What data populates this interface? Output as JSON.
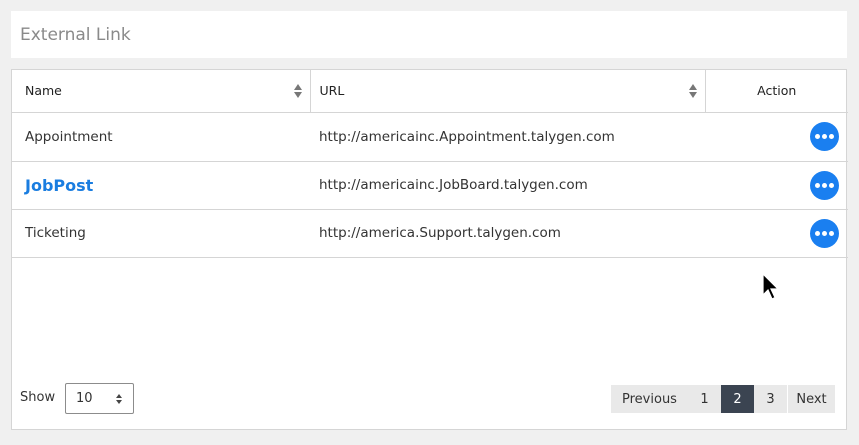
{
  "header": {
    "title": "External Link"
  },
  "table": {
    "columns": {
      "name": "Name",
      "url": "URL",
      "action": "Action"
    },
    "rows": [
      {
        "name": "Appointment",
        "url": "http://americainc.Appointment.talygen.com",
        "action_icon": "more-horizontal-icon"
      },
      {
        "name": "JobPost",
        "url": "http://americainc.JobBoard.talygen.com",
        "action_icon": "more-horizontal-icon"
      },
      {
        "name": "Ticketing",
        "url": "http://america.Support.talygen.com",
        "action_icon": "more-horizontal-icon"
      }
    ]
  },
  "footer": {
    "show_label": "Show",
    "page_size": "10",
    "pagination": {
      "previous": "Previous",
      "pages": [
        "1",
        "2",
        "3"
      ],
      "current": "2",
      "next": "Next"
    }
  },
  "colors": {
    "accent": "#1a7ff0",
    "link": "#1a7de0",
    "active_page": "#3b4451"
  }
}
